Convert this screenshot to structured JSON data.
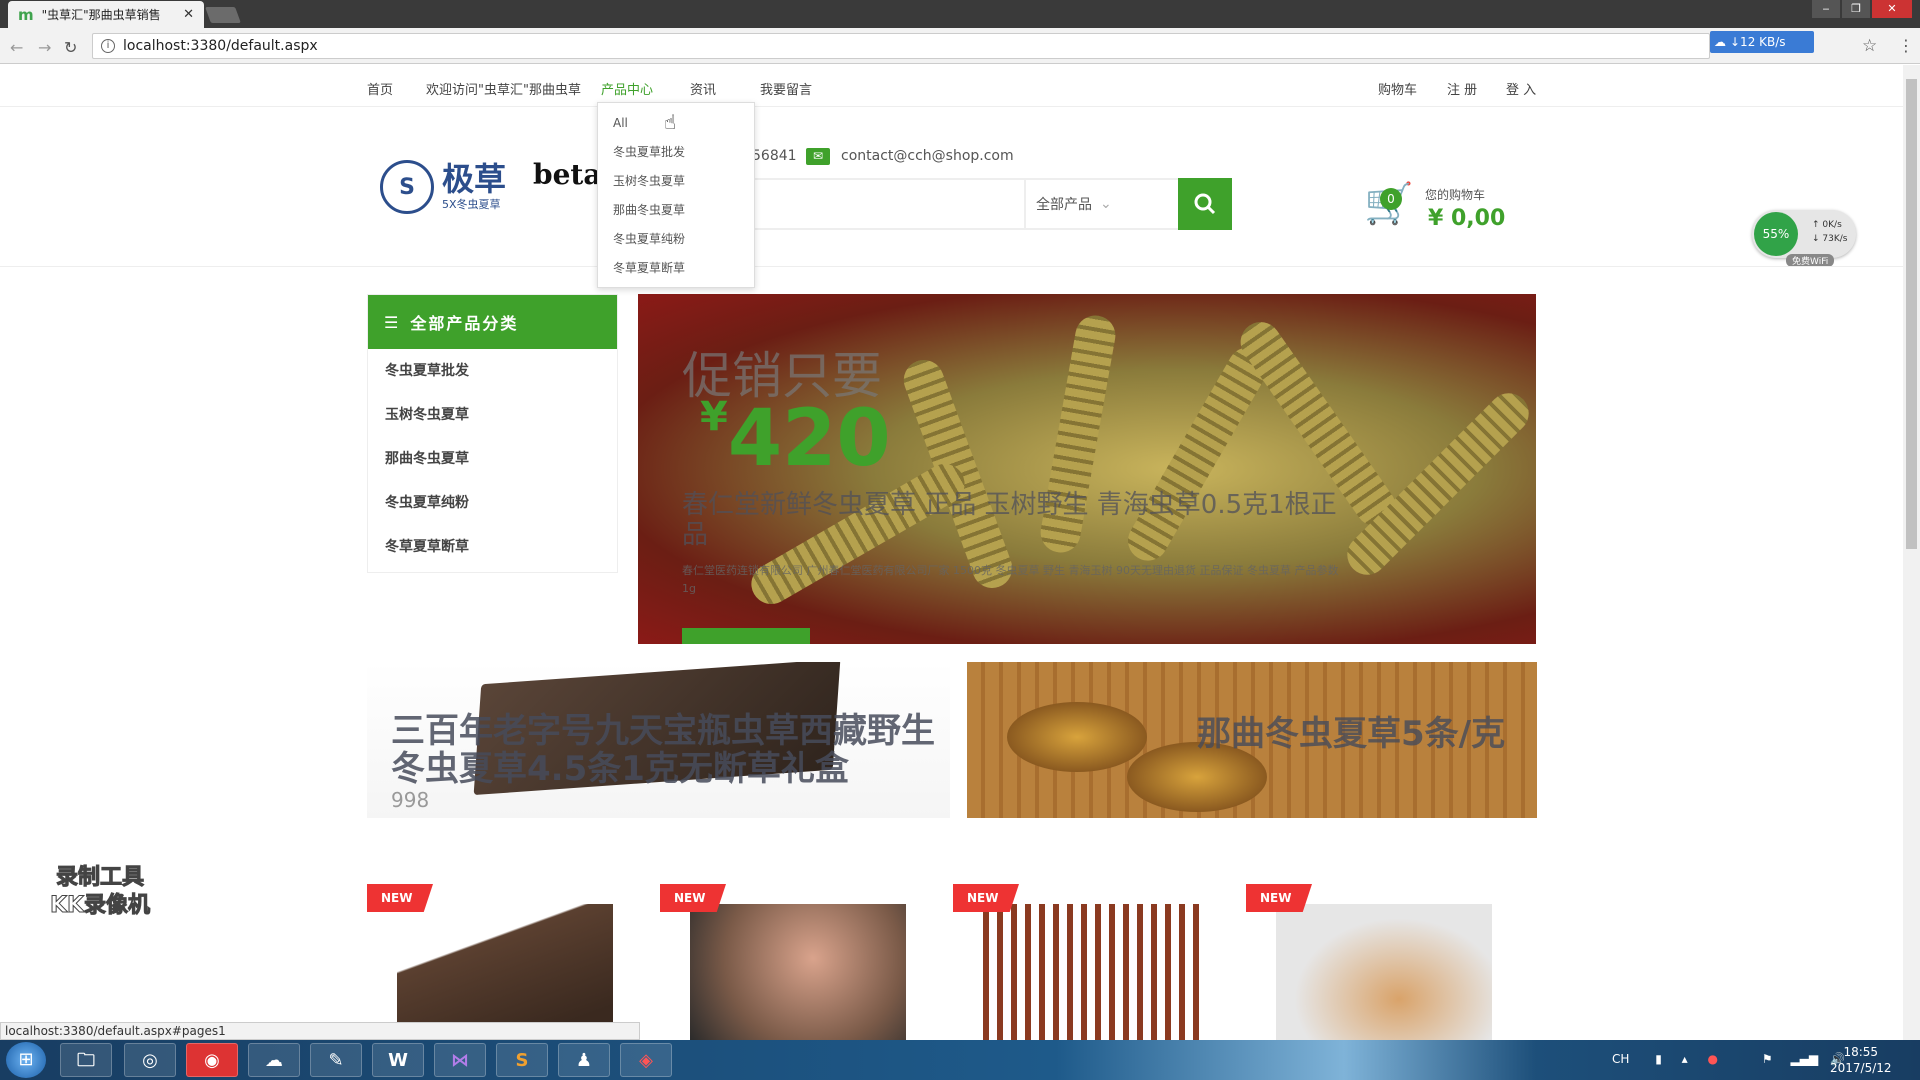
{
  "browser": {
    "tab_title": "\"虫草汇\"那曲虫草销售",
    "tab_favicon": "m",
    "url": "localhost:3380/default.aspx",
    "speed_badge": "↓12 KB/s",
    "status_url": "localhost:3380/default.aspx#pages1"
  },
  "topnav": {
    "items": [
      "首页",
      "欢迎访问\"虫草汇\"那曲虫草",
      "产品中心",
      "资讯",
      "我要留言"
    ],
    "right": [
      "购物车",
      "注 册",
      "登 入"
    ]
  },
  "dropdown": {
    "items": [
      "All",
      "冬虫夏草批发",
      "玉树冬虫夏草",
      "那曲冬虫夏草",
      "冬虫夏草纯粉",
      "冬草夏草断草"
    ]
  },
  "header": {
    "logo_big": "极草",
    "logo_small": "5X冬虫夏草",
    "beta": "beta",
    "phone_fragment": "56841",
    "email": "contact@cch@shop.com",
    "search_category": "全部产品",
    "cart_count": "0",
    "cart_label": "您的购物车",
    "cart_total": "¥ 0,00"
  },
  "widget": {
    "percent": "55%",
    "up": "0K/s",
    "down": "73K/s",
    "wifi": "免费WiFi"
  },
  "sidebar": {
    "title": "全部产品分类",
    "items": [
      "冬虫夏草批发",
      "玉树冬虫夏草",
      "那曲冬虫夏草",
      "冬虫夏草纯粉",
      "冬草夏草断草"
    ]
  },
  "banner": {
    "title": "促销只要",
    "currency": "¥",
    "price": "420",
    "subtitle": "春仁堂新鲜冬虫夏草 正品 玉树野生 青海虫草0.5克1根正品",
    "desc": "春仁堂医药连锁有限公司 广州春仁堂医药有限公司厂家 1500克 冬虫夏草 野生 青海玉树 90天无理由退货 正品保证 冬虫夏草 产品参数 1g"
  },
  "promo": {
    "left_title": "三百年老字号九天宝瓶虫草西藏野生冬虫夏草4.5条1克无断草礼盒",
    "left_price": "998",
    "right_title": "那曲冬虫夏草5条/克"
  },
  "products": {
    "badge": "NEW"
  },
  "watermark": {
    "line1": "录制工具",
    "line2": "KK录像机"
  },
  "taskbar": {
    "lang": "CH",
    "time": "18:55",
    "date": "2017/5/12"
  }
}
